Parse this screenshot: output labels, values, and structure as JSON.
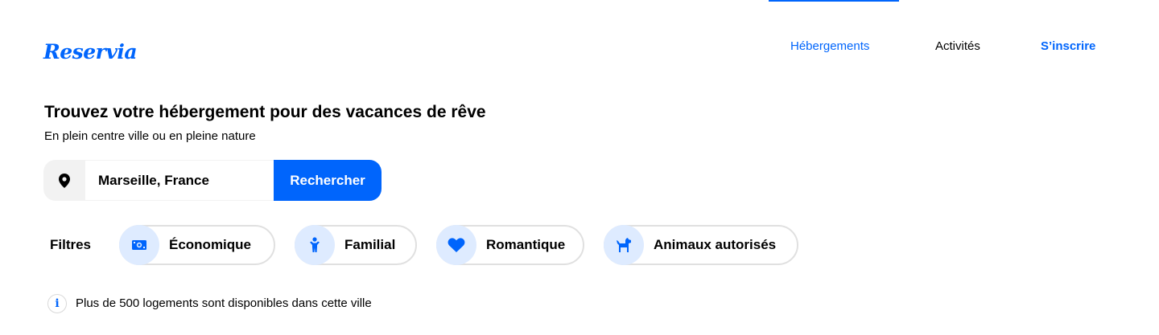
{
  "header": {
    "logo": "Reservia",
    "nav": {
      "hebergements": "Hébergements",
      "activites": "Activités",
      "inscrire": "S’inscrire"
    }
  },
  "hero": {
    "title": "Trouvez votre hébergement pour des vacances de rêve",
    "subtitle": "En plein centre ville ou en pleine nature"
  },
  "search": {
    "icon": "location-pin-icon",
    "value": "Marseille, France",
    "button": "Rechercher"
  },
  "filters": {
    "label": "Filtres",
    "items": [
      {
        "label": "Économique",
        "icon": "money-icon"
      },
      {
        "label": "Familial",
        "icon": "child-icon"
      },
      {
        "label": "Romantique",
        "icon": "heart-icon"
      },
      {
        "label": "Animaux autorisés",
        "icon": "dog-icon"
      }
    ]
  },
  "info": {
    "icon": "info-icon",
    "text": "Plus de 500 logements sont disponibles dans cette ville"
  },
  "colors": {
    "accent": "#0065fc",
    "accent_light": "#deebff",
    "chip_border": "#e0e0e0",
    "search_icon_bg": "#f2f2f2"
  }
}
